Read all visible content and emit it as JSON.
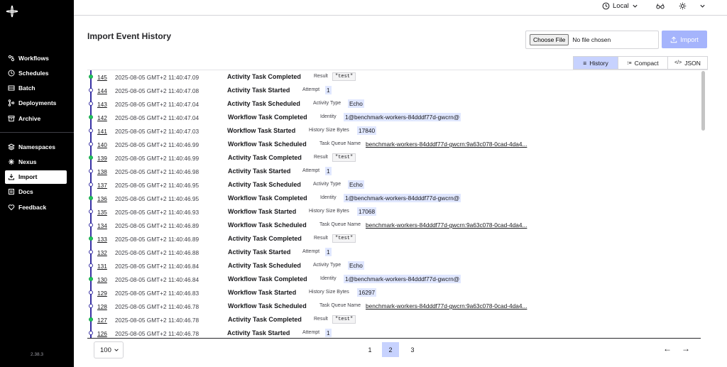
{
  "app": {
    "version": "2.38.3",
    "nav_primary": [
      {
        "label": "Workflows",
        "icon": "workflows-icon"
      },
      {
        "label": "Schedules",
        "icon": "schedules-icon"
      },
      {
        "label": "Batch",
        "icon": "batch-icon"
      },
      {
        "label": "Deployments",
        "icon": "deployments-icon"
      },
      {
        "label": "Archive",
        "icon": "archive-icon"
      }
    ],
    "nav_secondary": [
      {
        "label": "Namespaces",
        "icon": "namespaces-icon"
      },
      {
        "label": "Nexus",
        "icon": "nexus-icon"
      },
      {
        "label": "Import",
        "icon": "import-icon",
        "active": true
      },
      {
        "label": "Docs",
        "icon": "docs-icon"
      },
      {
        "label": "Feedback",
        "icon": "feedback-icon"
      }
    ]
  },
  "topbar": {
    "environment_label": "Local"
  },
  "page": {
    "title": "Import Event History",
    "file_button": "Choose File",
    "file_status": "No file chosen",
    "import_label": "Import",
    "view_tabs": [
      "History",
      "Compact",
      "JSON"
    ],
    "active_view": "History"
  },
  "events": [
    {
      "id": "145",
      "date": "2025-08-05 GMT+2 11:40:47.09",
      "name": "Activity Task Completed",
      "label": "Result",
      "value": "\"test\"",
      "vtype": "code",
      "dot": "green"
    },
    {
      "id": "144",
      "date": "2025-08-05 GMT+2 11:40:47.08",
      "name": "Activity Task Started",
      "label": "Attempt",
      "value": "1",
      "vtype": "plain",
      "dot": "plain"
    },
    {
      "id": "143",
      "date": "2025-08-05 GMT+2 11:40:47.04",
      "name": "Activity Task Scheduled",
      "label": "Activity Type",
      "value": "Echo",
      "vtype": "plain",
      "dot": "plain"
    },
    {
      "id": "142",
      "date": "2025-08-05 GMT+2 11:40:47.04",
      "name": "Workflow Task Completed",
      "label": "Identity",
      "value": "1@benchmark-workers-84dddf77d-gwcrn@",
      "vtype": "plain",
      "dot": "green"
    },
    {
      "id": "141",
      "date": "2025-08-05 GMT+2 11:40:47.03",
      "name": "Workflow Task Started",
      "label": "History Size Bytes",
      "value": "17840",
      "vtype": "plain",
      "dot": "plain"
    },
    {
      "id": "140",
      "date": "2025-08-05 GMT+2 11:40:46.99",
      "name": "Workflow Task Scheduled",
      "label": "Task Queue Name",
      "value": "benchmark-workers-84dddf77d-gwcrn:9a63c078-0cad-4da4...",
      "vtype": "link",
      "dot": "plain"
    },
    {
      "id": "139",
      "date": "2025-08-05 GMT+2 11:40:46.99",
      "name": "Activity Task Completed",
      "label": "Result",
      "value": "\"test\"",
      "vtype": "code",
      "dot": "green"
    },
    {
      "id": "138",
      "date": "2025-08-05 GMT+2 11:40:46.98",
      "name": "Activity Task Started",
      "label": "Attempt",
      "value": "1",
      "vtype": "plain",
      "dot": "plain"
    },
    {
      "id": "137",
      "date": "2025-08-05 GMT+2 11:40:46.95",
      "name": "Activity Task Scheduled",
      "label": "Activity Type",
      "value": "Echo",
      "vtype": "plain",
      "dot": "plain"
    },
    {
      "id": "136",
      "date": "2025-08-05 GMT+2 11:40:46.95",
      "name": "Workflow Task Completed",
      "label": "Identity",
      "value": "1@benchmark-workers-84dddf77d-gwcrn@",
      "vtype": "plain",
      "dot": "green"
    },
    {
      "id": "135",
      "date": "2025-08-05 GMT+2 11:40:46.93",
      "name": "Workflow Task Started",
      "label": "History Size Bytes",
      "value": "17068",
      "vtype": "plain",
      "dot": "plain"
    },
    {
      "id": "134",
      "date": "2025-08-05 GMT+2 11:40:46.89",
      "name": "Workflow Task Scheduled",
      "label": "Task Queue Name",
      "value": "benchmark-workers-84dddf77d-gwcrn:9a63c078-0cad-4da4...",
      "vtype": "link",
      "dot": "plain"
    },
    {
      "id": "133",
      "date": "2025-08-05 GMT+2 11:40:46.89",
      "name": "Activity Task Completed",
      "label": "Result",
      "value": "\"test\"",
      "vtype": "code",
      "dot": "green"
    },
    {
      "id": "132",
      "date": "2025-08-05 GMT+2 11:40:46.88",
      "name": "Activity Task Started",
      "label": "Attempt",
      "value": "1",
      "vtype": "plain",
      "dot": "plain"
    },
    {
      "id": "131",
      "date": "2025-08-05 GMT+2 11:40:46.84",
      "name": "Activity Task Scheduled",
      "label": "Activity Type",
      "value": "Echo",
      "vtype": "plain",
      "dot": "plain"
    },
    {
      "id": "130",
      "date": "2025-08-05 GMT+2 11:40:46.84",
      "name": "Workflow Task Completed",
      "label": "Identity",
      "value": "1@benchmark-workers-84dddf77d-gwcrn@",
      "vtype": "plain",
      "dot": "green"
    },
    {
      "id": "129",
      "date": "2025-08-05 GMT+2 11:40:46.83",
      "name": "Workflow Task Started",
      "label": "History Size Bytes",
      "value": "16297",
      "vtype": "plain",
      "dot": "plain"
    },
    {
      "id": "128",
      "date": "2025-08-05 GMT+2 11:40:46.78",
      "name": "Workflow Task Scheduled",
      "label": "Task Queue Name",
      "value": "benchmark-workers-84dddf77d-gwcrn:9a63c078-0cad-4da4...",
      "vtype": "link",
      "dot": "plain"
    },
    {
      "id": "127",
      "date": "2025-08-05 GMT+2 11:40:46.78",
      "name": "Activity Task Completed",
      "label": "Result",
      "value": "\"test\"",
      "vtype": "code",
      "dot": "green"
    },
    {
      "id": "126",
      "date": "2025-08-05 GMT+2 11:40:46.78",
      "name": "Activity Task Started",
      "label": "Attempt",
      "value": "1",
      "vtype": "plain",
      "dot": "plain"
    }
  ],
  "pagination": {
    "per_page": "100",
    "pages": [
      "1",
      "2",
      "3"
    ],
    "current": "2",
    "prev": "←",
    "next": "→"
  },
  "colors": {
    "sidebar_bg": "#000000",
    "accent": "#c7d2fe",
    "import_button": "#a5b4fc",
    "timeline": "#3730a3",
    "completed_dot": "#22c55e"
  }
}
